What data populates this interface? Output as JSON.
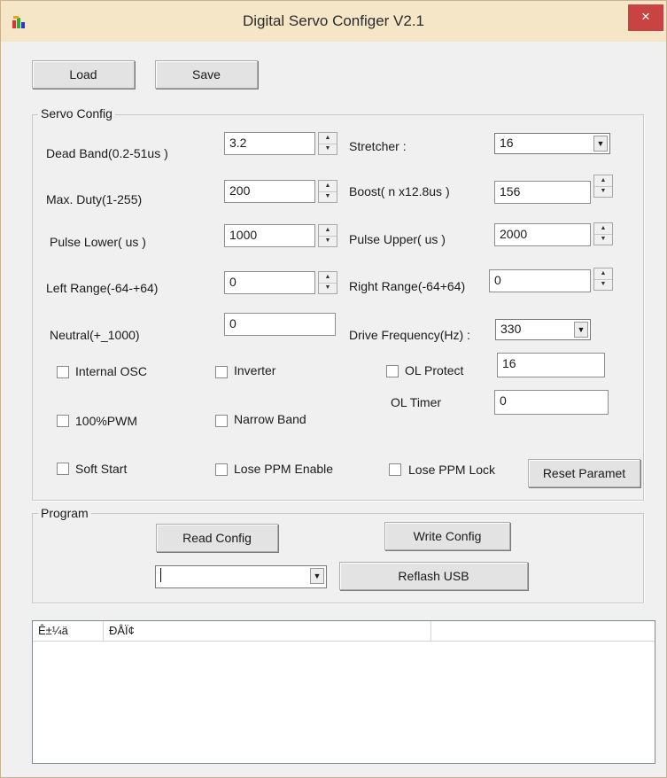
{
  "window": {
    "title": "Digital Servo Configer V2.1",
    "close": "×",
    "app_icon": "app-icon"
  },
  "toolbar": {
    "load_label": "Load",
    "save_label": "Save"
  },
  "servo_config": {
    "title": "Servo Config",
    "dead_band": {
      "label": "Dead Band(0.2-51us )",
      "value": "3.2"
    },
    "stretcher": {
      "label": "Stretcher :",
      "value": "16"
    },
    "max_duty": {
      "label": "Max. Duty(1-255)",
      "value": "200"
    },
    "boost": {
      "label": "Boost( n x12.8us )",
      "value": "156"
    },
    "pulse_lower": {
      "label": "Pulse Lower( us )",
      "value": "1000"
    },
    "pulse_upper": {
      "label": "Pulse Upper( us )",
      "value": "2000"
    },
    "left_range": {
      "label": "Left Range(-64-+64)",
      "value": "0"
    },
    "right_range": {
      "label": "Right Range(-64+64)",
      "value": "0"
    },
    "neutral": {
      "label": "Neutral(+_1000)",
      "value": "0"
    },
    "drive_frequency": {
      "label": "Drive Frequency(Hz) :",
      "value": "330"
    },
    "checkboxes": {
      "internal_osc": "Internal OSC",
      "inverter": "Inverter",
      "ol_protect": "OL Protect",
      "pwm100": "100%PWM",
      "narrow_band": "Narrow Band",
      "soft_start": "Soft Start",
      "lose_ppm_enable": "Lose PPM Enable",
      "lose_ppm_lock": "Lose PPM Lock"
    },
    "ol_protect_value": "16",
    "ol_timer": {
      "label": "OL Timer",
      "value": "0"
    },
    "reset_label": "Reset Paramet"
  },
  "program": {
    "title": "Program",
    "read_config_label": "Read Config",
    "write_config_label": "Write Config",
    "port_value": "",
    "reflash_label": "Reflash USB"
  },
  "log": {
    "columns": [
      "Ê±¼ä",
      "ĐÅÏ¢",
      ""
    ]
  }
}
